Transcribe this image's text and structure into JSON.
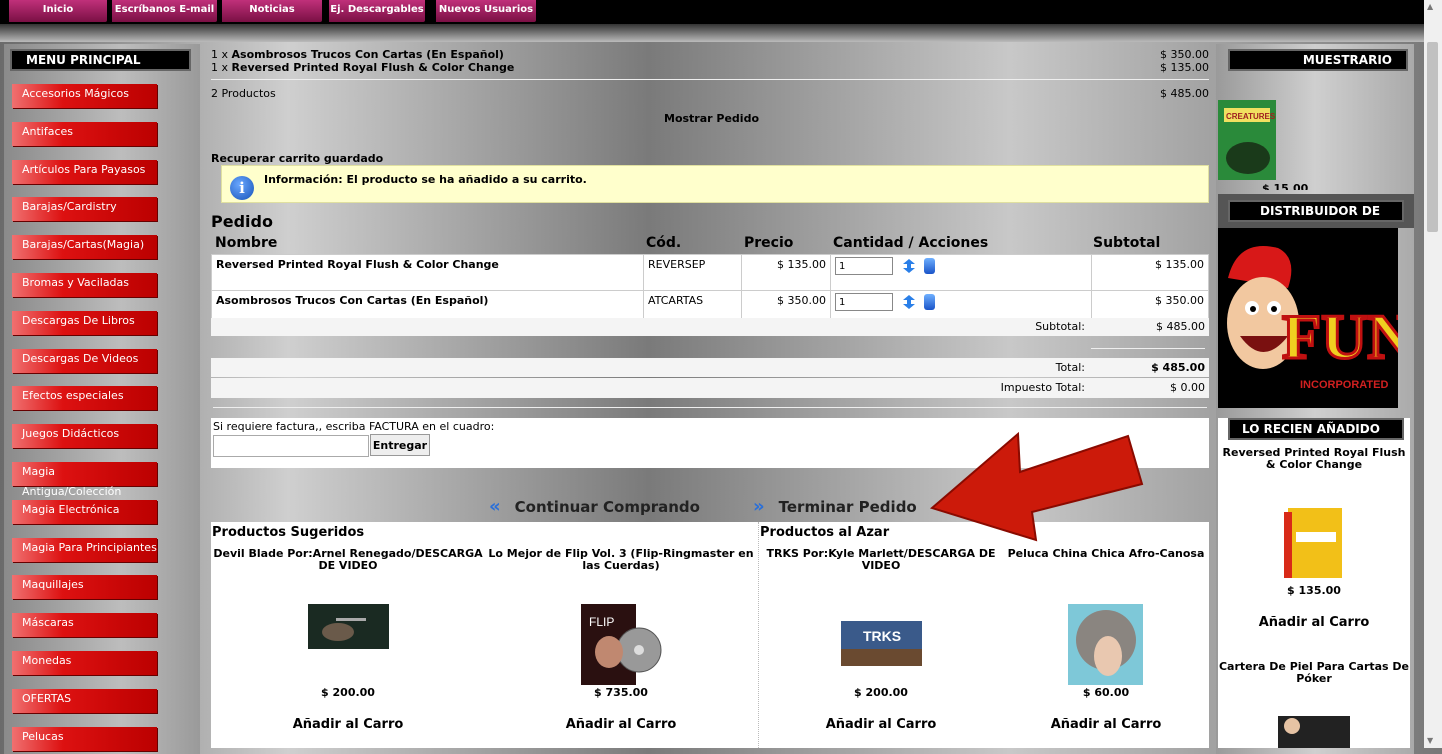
{
  "topnav": [
    "Inicio",
    "Escríbanos E-mail",
    "Noticias",
    "Ej. Descargables",
    "Nuevos Usuarios"
  ],
  "left_menu": {
    "title": "MENU PRINCIPAL",
    "items": [
      "Accesorios Mágicos",
      "Antifaces",
      "Artículos Para Payasos",
      "Barajas/Cardistry",
      "Barajas/Cartas(Magia)",
      "Bromas y Vaciladas",
      "Descargas De Libros",
      "Descargas De Videos",
      "Efectos especiales",
      "Juegos Didácticos",
      "Magia Antigua/Colección",
      "Magia Electrónica",
      "Magia Para Principiantes",
      "Maquillajes",
      "Máscaras",
      "Monedas",
      "OFERTAS",
      "Pelucas"
    ]
  },
  "mini_cart": {
    "lines": [
      {
        "qty": "1 x",
        "name": "Asombrosos Trucos Con Cartas (En Español)",
        "price": "$ 350.00"
      },
      {
        "qty": "1 x",
        "name": "Reversed Printed Royal Flush & Color Change",
        "price": "$ 135.00"
      }
    ],
    "count": "2 Productos",
    "total": "$ 485.00",
    "show_order": "Mostrar Pedido",
    "recover": "Recuperar carrito guardado"
  },
  "info": {
    "icon": "i",
    "message": "Información: El producto se ha añadido a su carrito."
  },
  "order": {
    "title": "Pedido",
    "columns": [
      "Nombre",
      "Cód.",
      "Precio",
      "Cantidad / Acciones",
      "Subtotal"
    ],
    "rows": [
      {
        "name": "Reversed Printed Royal Flush & Color Change",
        "code": "REVERSEP",
        "price": "$ 135.00",
        "qty": "1",
        "subtotal": "$ 135.00"
      },
      {
        "name": "Asombrosos Trucos Con Cartas (En Español)",
        "code": "ATCARTAS",
        "price": "$ 350.00",
        "qty": "1",
        "subtotal": "$ 350.00"
      }
    ],
    "subtotal_label": "Subtotal:",
    "subtotal_value": "$ 485.00",
    "total_label": "Total:",
    "total_value": "$ 485.00",
    "tax_label": "Impuesto Total:",
    "tax_value": "$ 0.00"
  },
  "factura": {
    "label": "Si requiere factura,, escriba FACTURA en el cuadro:",
    "value": "",
    "button": "Entregar"
  },
  "nav": {
    "continue": "Continuar Comprando",
    "checkout": "Terminar Pedido",
    "chevron_left": "«",
    "chevron_right": "»"
  },
  "suggested": {
    "title": "Productos Sugeridos",
    "items": [
      {
        "name": "Devil Blade Por:Arnel Renegado/DESCARGA DE VIDEO",
        "price": "$ 200.00",
        "add": "Añadir al Carro"
      },
      {
        "name": "Lo Mejor de Flip Vol. 3 (Flip-Ringmaster en las Cuerdas)",
        "price": "$ 735.00",
        "add": "Añadir al Carro"
      }
    ]
  },
  "random": {
    "title": "Productos al Azar",
    "items": [
      {
        "name": "TRKS Por:Kyle Marlett/DESCARGA DE VIDEO",
        "price": "$ 200.00",
        "add": "Añadir al Carro"
      },
      {
        "name": "Peluca China Chica Afro-Canosa",
        "price": "$ 60.00",
        "add": "Añadir al Carro"
      }
    ]
  },
  "right": {
    "muestrario": "MUESTRARIO",
    "muestrario_price": "$ 15.00",
    "muestrario_img_text": "CREATURES",
    "distribuidor": "DISTRIBUIDOR DE",
    "fun_text": "FUN",
    "fun_sub": "INCORPORATED",
    "recent_title": "LO RECIEN AÑADIDO",
    "recent_item": "Reversed Printed Royal Flush & Color Change",
    "recent_price": "$ 135.00",
    "recent_add": "Añadir al Carro",
    "recent_item2": "Cartera De Piel Para Cartas De Póker"
  },
  "images": {
    "trks_text": "TRKS",
    "flip_text": "FLIP"
  },
  "colors": {
    "menu_red": "#cc1111",
    "nav_magenta": "#a01c5c",
    "info_bg": "#ffffcc",
    "arrow_red": "#cc1a0a",
    "chevron_blue": "#2a6fd8"
  }
}
